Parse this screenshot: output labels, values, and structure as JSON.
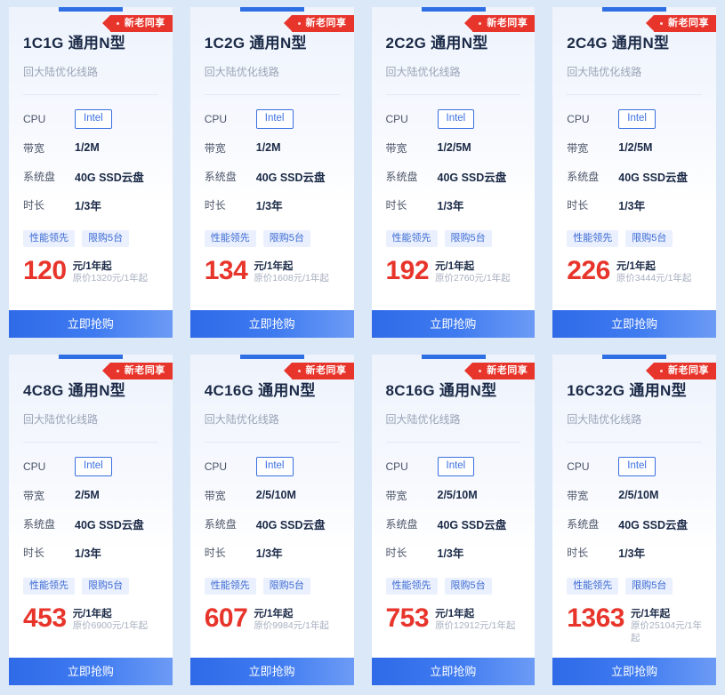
{
  "page": {
    "background_color": "#dbe8f8",
    "accent_color": "#2f6fe4",
    "ribbon_color": "#e8352c",
    "price_color": "#e8352c"
  },
  "labels": {
    "cpu": "CPU",
    "bandwidth": "带宽",
    "disk": "系统盘",
    "duration": "时长",
    "ribbon": "新老同享",
    "tag_performance": "性能领先",
    "tag_limit": "限购5台",
    "price_unit": "元/1年起",
    "buy_button": "立即抢购",
    "subtitle": "回大陆优化线路"
  },
  "cards": [
    {
      "title": "1C1G 通用N型",
      "subtitle": "回大陆优化线路",
      "ribbon": "新老同享",
      "cpu": "Intel",
      "bandwidth": "1/2M",
      "disk": "40G SSD云盘",
      "duration": "1/3年",
      "tag_performance": "性能领先",
      "tag_limit": "限购5台",
      "price": "120",
      "price_unit": "元/1年起",
      "original_price": "原价1320元/1年起",
      "buy_button": "立即抢购"
    },
    {
      "title": "1C2G 通用N型",
      "subtitle": "回大陆优化线路",
      "ribbon": "新老同享",
      "cpu": "Intel",
      "bandwidth": "1/2M",
      "disk": "40G SSD云盘",
      "duration": "1/3年",
      "tag_performance": "性能领先",
      "tag_limit": "限购5台",
      "price": "134",
      "price_unit": "元/1年起",
      "original_price": "原价1608元/1年起",
      "buy_button": "立即抢购"
    },
    {
      "title": "2C2G 通用N型",
      "subtitle": "回大陆优化线路",
      "ribbon": "新老同享",
      "cpu": "Intel",
      "bandwidth": "1/2/5M",
      "disk": "40G SSD云盘",
      "duration": "1/3年",
      "tag_performance": "性能领先",
      "tag_limit": "限购5台",
      "price": "192",
      "price_unit": "元/1年起",
      "original_price": "原价2760元/1年起",
      "buy_button": "立即抢购"
    },
    {
      "title": "2C4G 通用N型",
      "subtitle": "回大陆优化线路",
      "ribbon": "新老同享",
      "cpu": "Intel",
      "bandwidth": "1/2/5M",
      "disk": "40G SSD云盘",
      "duration": "1/3年",
      "tag_performance": "性能领先",
      "tag_limit": "限购5台",
      "price": "226",
      "price_unit": "元/1年起",
      "original_price": "原价3444元/1年起",
      "buy_button": "立即抢购"
    },
    {
      "title": "4C8G 通用N型",
      "subtitle": "回大陆优化线路",
      "ribbon": "新老同享",
      "cpu": "Intel",
      "bandwidth": "2/5M",
      "disk": "40G SSD云盘",
      "duration": "1/3年",
      "tag_performance": "性能领先",
      "tag_limit": "限购5台",
      "price": "453",
      "price_unit": "元/1年起",
      "original_price": "原价6900元/1年起",
      "buy_button": "立即抢购"
    },
    {
      "title": "4C16G 通用N型",
      "subtitle": "回大陆优化线路",
      "ribbon": "新老同享",
      "cpu": "Intel",
      "bandwidth": "2/5/10M",
      "disk": "40G SSD云盘",
      "duration": "1/3年",
      "tag_performance": "性能领先",
      "tag_limit": "限购5台",
      "price": "607",
      "price_unit": "元/1年起",
      "original_price": "原价9984元/1年起",
      "buy_button": "立即抢购"
    },
    {
      "title": "8C16G 通用N型",
      "subtitle": "回大陆优化线路",
      "ribbon": "新老同享",
      "cpu": "Intel",
      "bandwidth": "2/5/10M",
      "disk": "40G SSD云盘",
      "duration": "1/3年",
      "tag_performance": "性能领先",
      "tag_limit": "限购5台",
      "price": "753",
      "price_unit": "元/1年起",
      "original_price": "原价12912元/1年起",
      "buy_button": "立即抢购"
    },
    {
      "title": "16C32G 通用N型",
      "subtitle": "回大陆优化线路",
      "ribbon": "新老同享",
      "cpu": "Intel",
      "bandwidth": "2/5/10M",
      "disk": "40G SSD云盘",
      "duration": "1/3年",
      "tag_performance": "性能领先",
      "tag_limit": "限购5台",
      "price": "1363",
      "price_unit": "元/1年起",
      "original_price": "原价25104元/1年起",
      "buy_button": "立即抢购"
    }
  ]
}
